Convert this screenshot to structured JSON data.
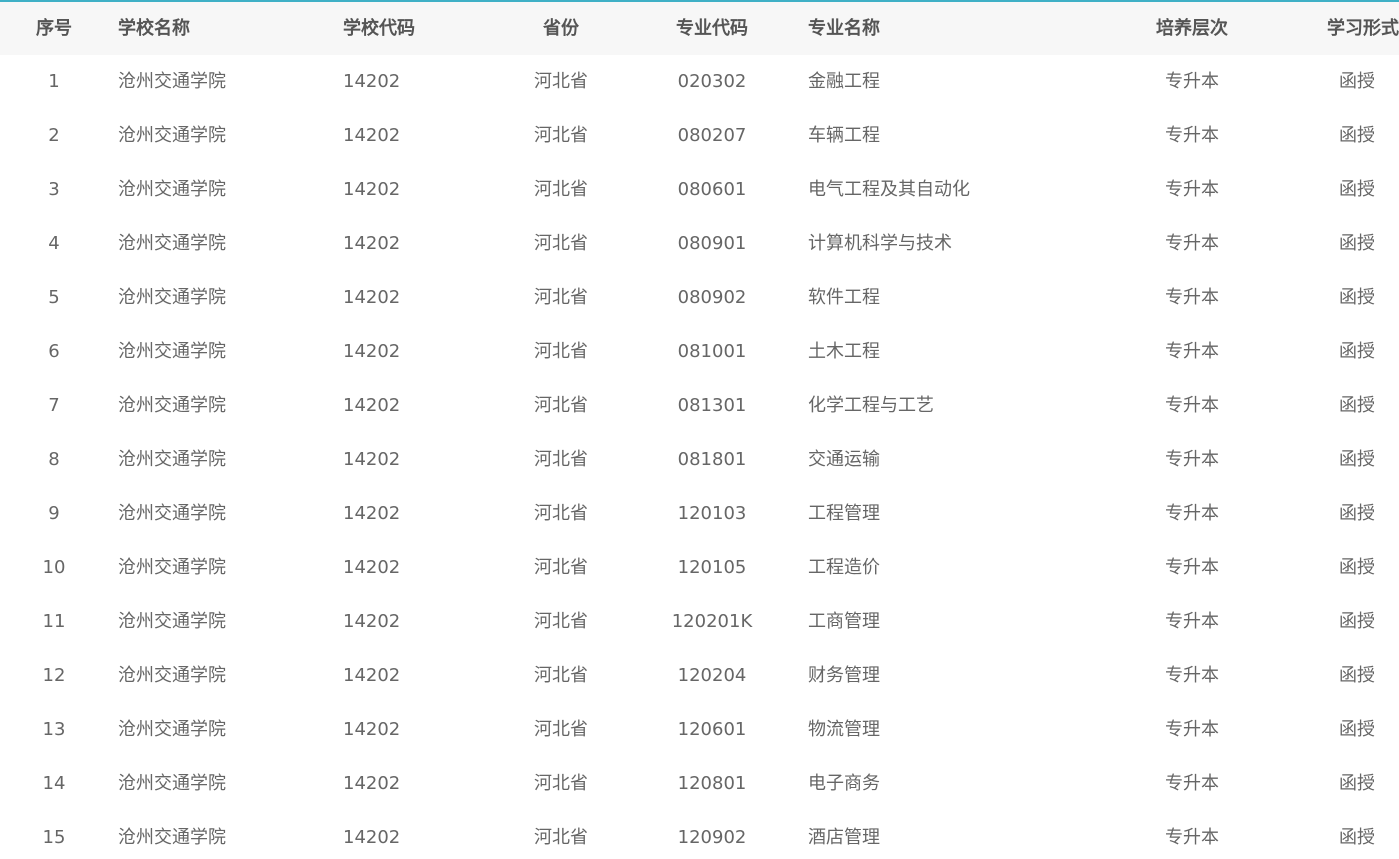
{
  "table": {
    "headers": {
      "seq": "序号",
      "school_name": "学校名称",
      "school_code": "学校代码",
      "province": "省份",
      "major_code": "专业代码",
      "major_name": "专业名称",
      "level": "培养层次",
      "study_form": "学习形式"
    },
    "rows": [
      {
        "seq": "1",
        "school_name": "沧州交通学院",
        "school_code": "14202",
        "province": "河北省",
        "major_code": "020302",
        "major_name": "金融工程",
        "level": "专升本",
        "study_form": "函授"
      },
      {
        "seq": "2",
        "school_name": "沧州交通学院",
        "school_code": "14202",
        "province": "河北省",
        "major_code": "080207",
        "major_name": "车辆工程",
        "level": "专升本",
        "study_form": "函授"
      },
      {
        "seq": "3",
        "school_name": "沧州交通学院",
        "school_code": "14202",
        "province": "河北省",
        "major_code": "080601",
        "major_name": "电气工程及其自动化",
        "level": "专升本",
        "study_form": "函授"
      },
      {
        "seq": "4",
        "school_name": "沧州交通学院",
        "school_code": "14202",
        "province": "河北省",
        "major_code": "080901",
        "major_name": "计算机科学与技术",
        "level": "专升本",
        "study_form": "函授"
      },
      {
        "seq": "5",
        "school_name": "沧州交通学院",
        "school_code": "14202",
        "province": "河北省",
        "major_code": "080902",
        "major_name": "软件工程",
        "level": "专升本",
        "study_form": "函授"
      },
      {
        "seq": "6",
        "school_name": "沧州交通学院",
        "school_code": "14202",
        "province": "河北省",
        "major_code": "081001",
        "major_name": "土木工程",
        "level": "专升本",
        "study_form": "函授"
      },
      {
        "seq": "7",
        "school_name": "沧州交通学院",
        "school_code": "14202",
        "province": "河北省",
        "major_code": "081301",
        "major_name": "化学工程与工艺",
        "level": "专升本",
        "study_form": "函授"
      },
      {
        "seq": "8",
        "school_name": "沧州交通学院",
        "school_code": "14202",
        "province": "河北省",
        "major_code": "081801",
        "major_name": "交通运输",
        "level": "专升本",
        "study_form": "函授"
      },
      {
        "seq": "9",
        "school_name": "沧州交通学院",
        "school_code": "14202",
        "province": "河北省",
        "major_code": "120103",
        "major_name": "工程管理",
        "level": "专升本",
        "study_form": "函授"
      },
      {
        "seq": "10",
        "school_name": "沧州交通学院",
        "school_code": "14202",
        "province": "河北省",
        "major_code": "120105",
        "major_name": "工程造价",
        "level": "专升本",
        "study_form": "函授"
      },
      {
        "seq": "11",
        "school_name": "沧州交通学院",
        "school_code": "14202",
        "province": "河北省",
        "major_code": "120201K",
        "major_name": "工商管理",
        "level": "专升本",
        "study_form": "函授"
      },
      {
        "seq": "12",
        "school_name": "沧州交通学院",
        "school_code": "14202",
        "province": "河北省",
        "major_code": "120204",
        "major_name": "财务管理",
        "level": "专升本",
        "study_form": "函授"
      },
      {
        "seq": "13",
        "school_name": "沧州交通学院",
        "school_code": "14202",
        "province": "河北省",
        "major_code": "120601",
        "major_name": "物流管理",
        "level": "专升本",
        "study_form": "函授"
      },
      {
        "seq": "14",
        "school_name": "沧州交通学院",
        "school_code": "14202",
        "province": "河北省",
        "major_code": "120801",
        "major_name": "电子商务",
        "level": "专升本",
        "study_form": "函授"
      },
      {
        "seq": "15",
        "school_name": "沧州交通学院",
        "school_code": "14202",
        "province": "河北省",
        "major_code": "120902",
        "major_name": "酒店管理",
        "level": "专升本",
        "study_form": "函授"
      }
    ]
  }
}
